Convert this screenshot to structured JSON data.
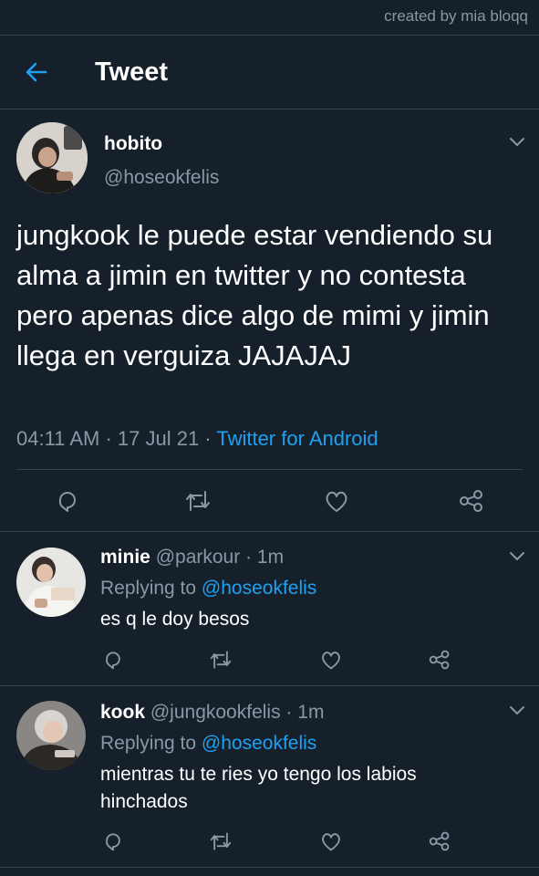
{
  "watermark": "created by mia bloqq",
  "header": {
    "title": "Tweet"
  },
  "tweet": {
    "display_name": "hobito",
    "handle": "@hoseokfelis",
    "text": "jungkook le puede estar vendiendo su alma a jimin en twitter y no contesta pero apenas dice algo de mimi y jimin llega en verguiza JAJAJAJ",
    "time": "04:11 AM",
    "date": "17 Jul 21",
    "source": "Twitter for Android"
  },
  "replies": [
    {
      "display_name": "minie",
      "handle": "@parkour",
      "age": "1m",
      "replying_label": "Replying to",
      "replying_to": "@hoseokfelis",
      "text": "es q le doy besos"
    },
    {
      "display_name": "kook",
      "handle": "@jungkookfelis",
      "age": "1m",
      "replying_label": "Replying to",
      "replying_to": "@hoseokfelis",
      "text": "mientras tu te ries yo tengo los labios hinchados"
    }
  ],
  "icons": [
    "back-arrow-icon",
    "chevron-down-icon",
    "reply-icon",
    "retweet-icon",
    "like-icon",
    "share-icon"
  ],
  "colors": {
    "background": "#15202b",
    "accent": "#1da1f2",
    "muted": "#8899a6",
    "divider": "#38444d"
  }
}
